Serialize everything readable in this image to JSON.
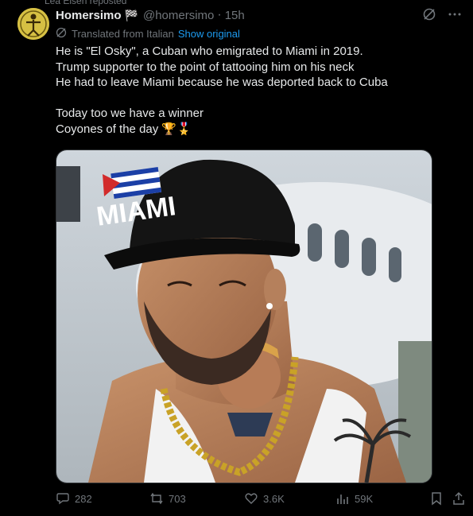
{
  "repost_label": "Lea Elsen reposted",
  "author": {
    "name": "Homersimo",
    "flag": "🏁",
    "handle": "@homersimo",
    "separator": "·",
    "time": "15h"
  },
  "translation": {
    "label": "Translated from Italian",
    "show_original": "Show original"
  },
  "body": "He is \"El Osky\", a Cuban who emigrated to Miami in 2019.\nTrump supporter to the point of tattooing him on his neck\nHe had to leave Miami because he was deported back to Cuba\n\nToday too we have a winner\nCoyones of the day 🏆🎖️",
  "media": {
    "cap_text": "MIAMI",
    "alt": "Photo of a man in a MIAMI cap with a Trump neck tattoo"
  },
  "actions": {
    "replies": "282",
    "reposts": "703",
    "likes": "3.6K",
    "views": "59K"
  },
  "icons": {
    "grok": "grok-icon",
    "more": "more-icon",
    "translate": "translate-icon",
    "reply": "reply-icon",
    "repost": "repost-icon",
    "like": "heart-icon",
    "views": "views-icon",
    "bookmark": "bookmark-icon",
    "share": "share-icon"
  },
  "colors": {
    "background": "#000000",
    "text": "#e7e9ea",
    "muted": "#71767b",
    "link": "#1d9bf0"
  }
}
